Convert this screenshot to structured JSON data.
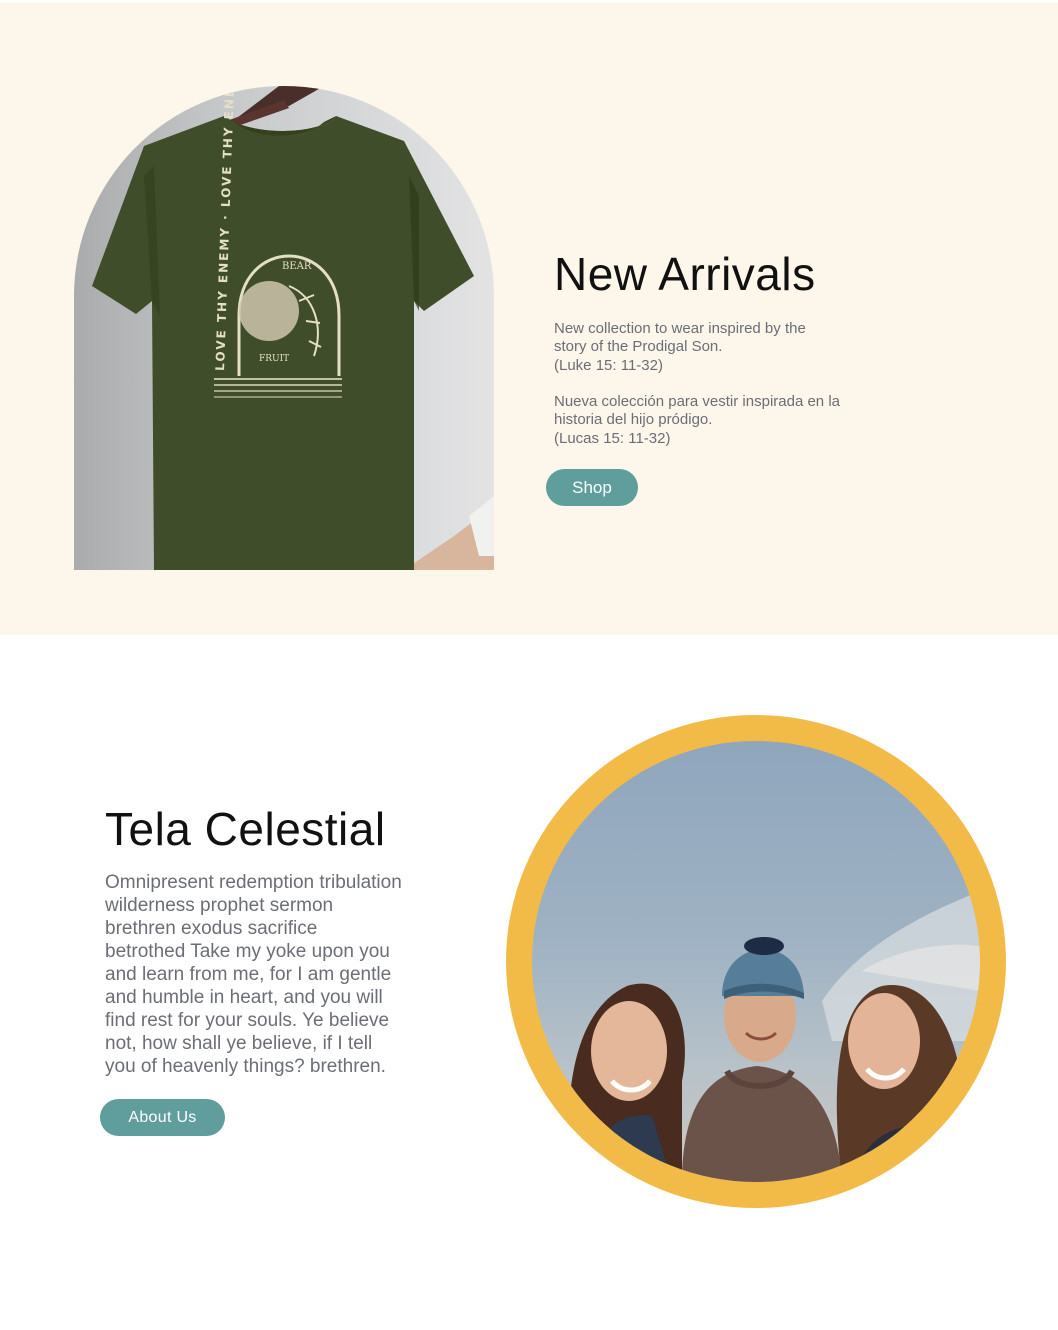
{
  "arrivals": {
    "title": "New Arrivals",
    "desc_en_lines": [
      "New collection to wear inspired by the",
      "story of the Prodigal Son.",
      "(Luke 15: 11-32)"
    ],
    "desc_es_lines": [
      "Nueva colección para vestir inspirada en la",
      "historia del hijo pródigo.",
      "(Lucas 15: 11-32)"
    ],
    "shop_label": "Shop",
    "photo": {
      "icon": "tshirt-photo",
      "print_text": [
        "LOVE THY ENEMY · LOVE THY ENEMY",
        "BEAR",
        "FRUIT"
      ]
    }
  },
  "celestial": {
    "title": "Tela Celestial",
    "body_lines": [
      "Omnipresent redemption tribulation",
      "wilderness prophet sermon",
      "brethren exodus sacrifice",
      "betrothed Take my yoke upon you",
      "and learn from me, for I am gentle",
      "and humble in heart, and you will",
      "find rest for your souls. Ye believe",
      "not, how shall ye believe, if I tell",
      "you of heavenly things? brethren."
    ],
    "about_label": "About Us",
    "photo": {
      "icon": "group-portrait-photo"
    }
  },
  "colors": {
    "section_bg": "#fcf6eb",
    "button": "#5f9e9c",
    "frame": "#f2bb48",
    "heading": "#111111",
    "body_text": "#6b6e76"
  }
}
